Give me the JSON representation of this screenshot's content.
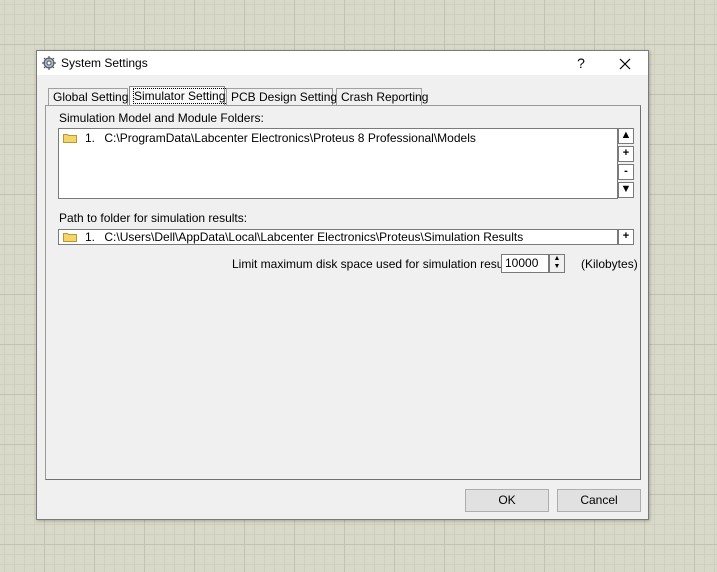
{
  "window": {
    "title": "System Settings",
    "help_label": "?",
    "close_label": "✕"
  },
  "tabs": [
    {
      "label": "Global Settings"
    },
    {
      "label": "Simulator Settings"
    },
    {
      "label": "PCB Design Settings"
    },
    {
      "label": "Crash Reporting"
    }
  ],
  "models_section": {
    "label": "Simulation Model and Module Folders:",
    "items": [
      {
        "index": "1.",
        "path": "C:\\ProgramData\\Labcenter Electronics\\Proteus 8 Professional\\Models"
      }
    ],
    "buttons": {
      "up": "▲",
      "add": "+",
      "remove": "-",
      "down": "▼"
    }
  },
  "results_section": {
    "label": "Path to folder for simulation results:",
    "item": {
      "index": "1.",
      "path": "C:\\Users\\Dell\\AppData\\Local\\Labcenter Electronics\\Proteus\\Simulation Results"
    },
    "add_button": "+"
  },
  "disk_limit": {
    "label": "Limit maximum disk space used for simulation results to:",
    "value": "10000",
    "unit": "(Kilobytes)"
  },
  "footer": {
    "ok_label": "OK",
    "cancel_label": "Cancel"
  },
  "icons": {
    "folder": "folder-icon",
    "app": "app-gear-icon"
  },
  "colors": {
    "folder_fill": "#f5d56b",
    "folder_stroke": "#b89a2c"
  }
}
